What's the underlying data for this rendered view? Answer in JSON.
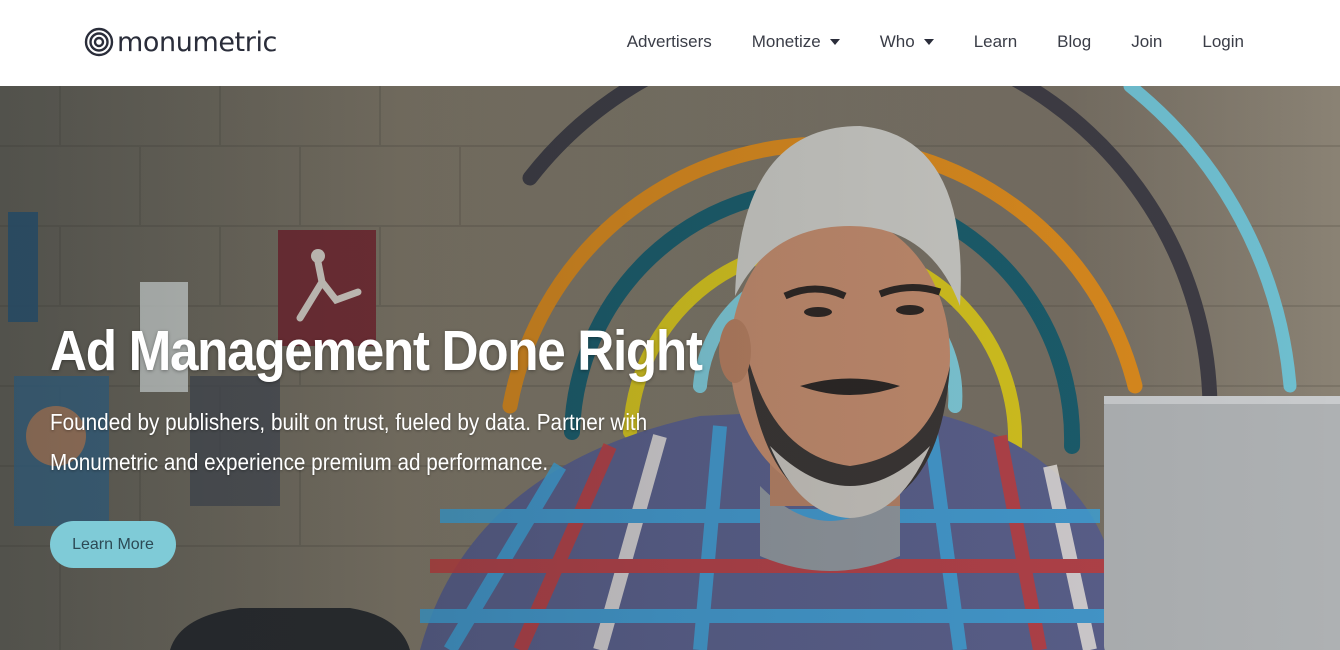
{
  "brand": {
    "name": "monumetric",
    "logo_icon": "concentric-circles-logo-icon"
  },
  "nav": {
    "items": [
      {
        "label": "Advertisers",
        "has_dropdown": false
      },
      {
        "label": "Monetize",
        "has_dropdown": true
      },
      {
        "label": "Who",
        "has_dropdown": true
      },
      {
        "label": "Learn",
        "has_dropdown": false
      },
      {
        "label": "Blog",
        "has_dropdown": false
      },
      {
        "label": "Join",
        "has_dropdown": false
      },
      {
        "label": "Login",
        "has_dropdown": false
      }
    ],
    "dropdown_icon": "caret-down-icon"
  },
  "hero": {
    "title": "Ad Management Done Right",
    "subtitle_line1": "Founded by publishers, built on trust, fueled by data. Partner with",
    "subtitle_line2": "Monumetric and experience premium ad performance.",
    "cta_label": "Learn More",
    "image": "man-with-gray-beard-at-laptop-photo",
    "arc_colors": [
      "#7ec8d6",
      "#d4c21e",
      "#1b5c6b",
      "#d9891d",
      "#3e3c44",
      "#6fbfd0"
    ]
  },
  "colors": {
    "header_bg": "#ffffff",
    "nav_text": "#3a3d47",
    "cta_bg": "#7fcbd7",
    "cta_text": "#2c4a55",
    "hero_text": "#ffffff"
  }
}
